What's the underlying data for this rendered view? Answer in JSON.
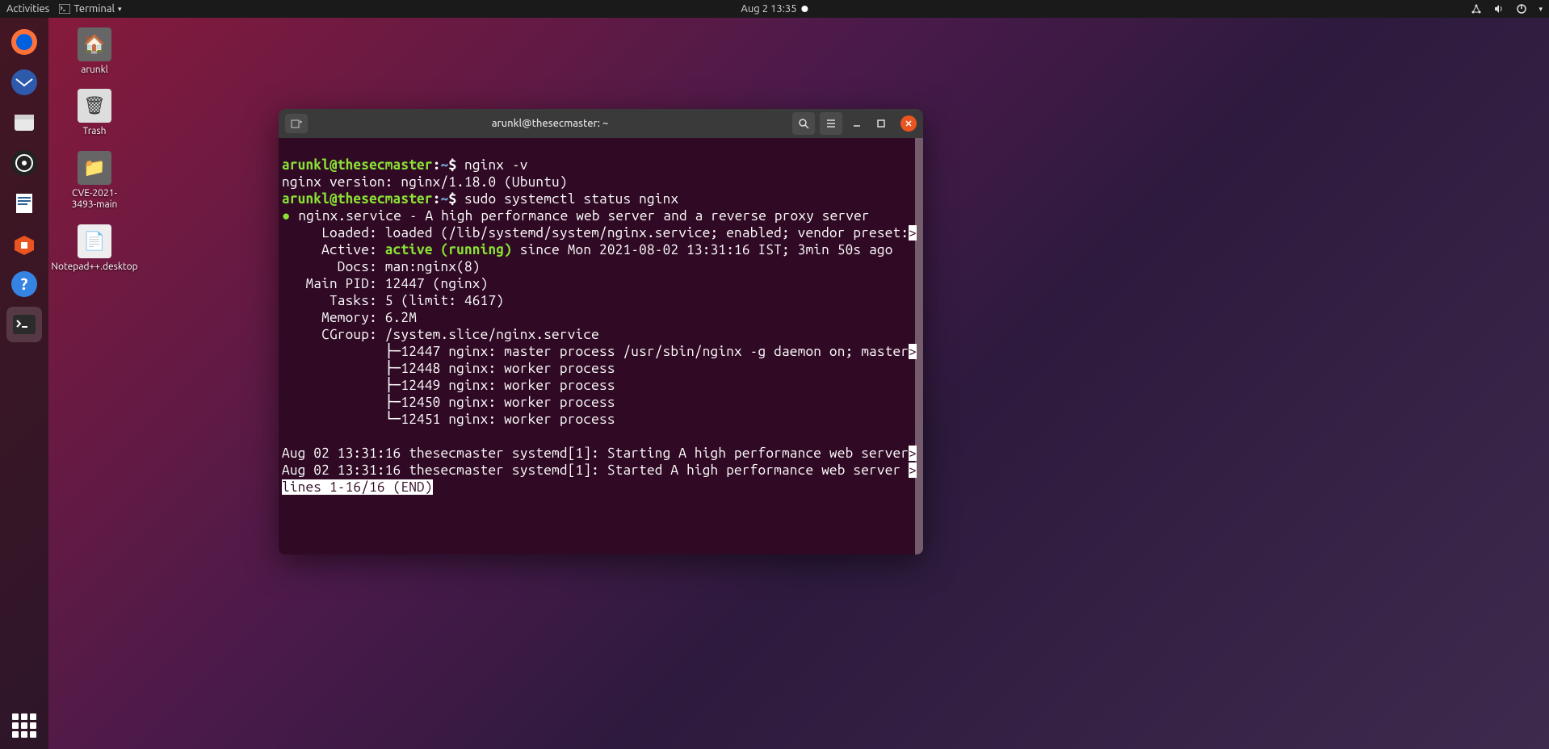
{
  "topbar": {
    "activities": "Activities",
    "app_menu": "Terminal",
    "datetime": "Aug 2  13:35"
  },
  "desktop_icons": [
    {
      "label": "arunkl",
      "type": "folder"
    },
    {
      "label": "Trash",
      "type": "trash"
    },
    {
      "label": "CVE-2021-3493-main",
      "type": "folder"
    },
    {
      "label": "Notepad++.desktop",
      "type": "text"
    }
  ],
  "terminal": {
    "title": "arunkl@thesecmaster: ~",
    "prompt_user": "arunkl@thesecmaster",
    "prompt_path": "~",
    "cmd1": "nginx -v",
    "out_version": "nginx version: nginx/1.18.0 (Ubuntu)",
    "cmd2": "sudo systemctl status nginx",
    "svc_line": "nginx.service - A high performance web server and a reverse proxy server",
    "loaded": "     Loaded: loaded (/lib/systemd/system/nginx.service; enabled; vendor preset:",
    "active_label": "     Active: ",
    "active_status": "active (running)",
    "active_rest": " since Mon 2021-08-02 13:31:16 IST; 3min 50s ago",
    "docs": "       Docs: man:nginx(8)",
    "mainpid": "   Main PID: 12447 (nginx)",
    "tasks": "      Tasks: 5 (limit: 4617)",
    "memory": "     Memory: 6.2M",
    "cgroup": "     CGroup: /system.slice/nginx.service",
    "proc1": "             ├─12447 nginx: master process /usr/sbin/nginx -g daemon on; master",
    "proc2": "             ├─12448 nginx: worker process",
    "proc3": "             ├─12449 nginx: worker process",
    "proc4": "             ├─12450 nginx: worker process",
    "proc5": "             └─12451 nginx: worker process",
    "log1": "Aug 02 13:31:16 thesecmaster systemd[1]: Starting A high performance web server",
    "log2": "Aug 02 13:31:16 thesecmaster systemd[1]: Started A high performance web server ",
    "pager": "lines 1-16/16 (END)",
    "arrow": ">"
  }
}
